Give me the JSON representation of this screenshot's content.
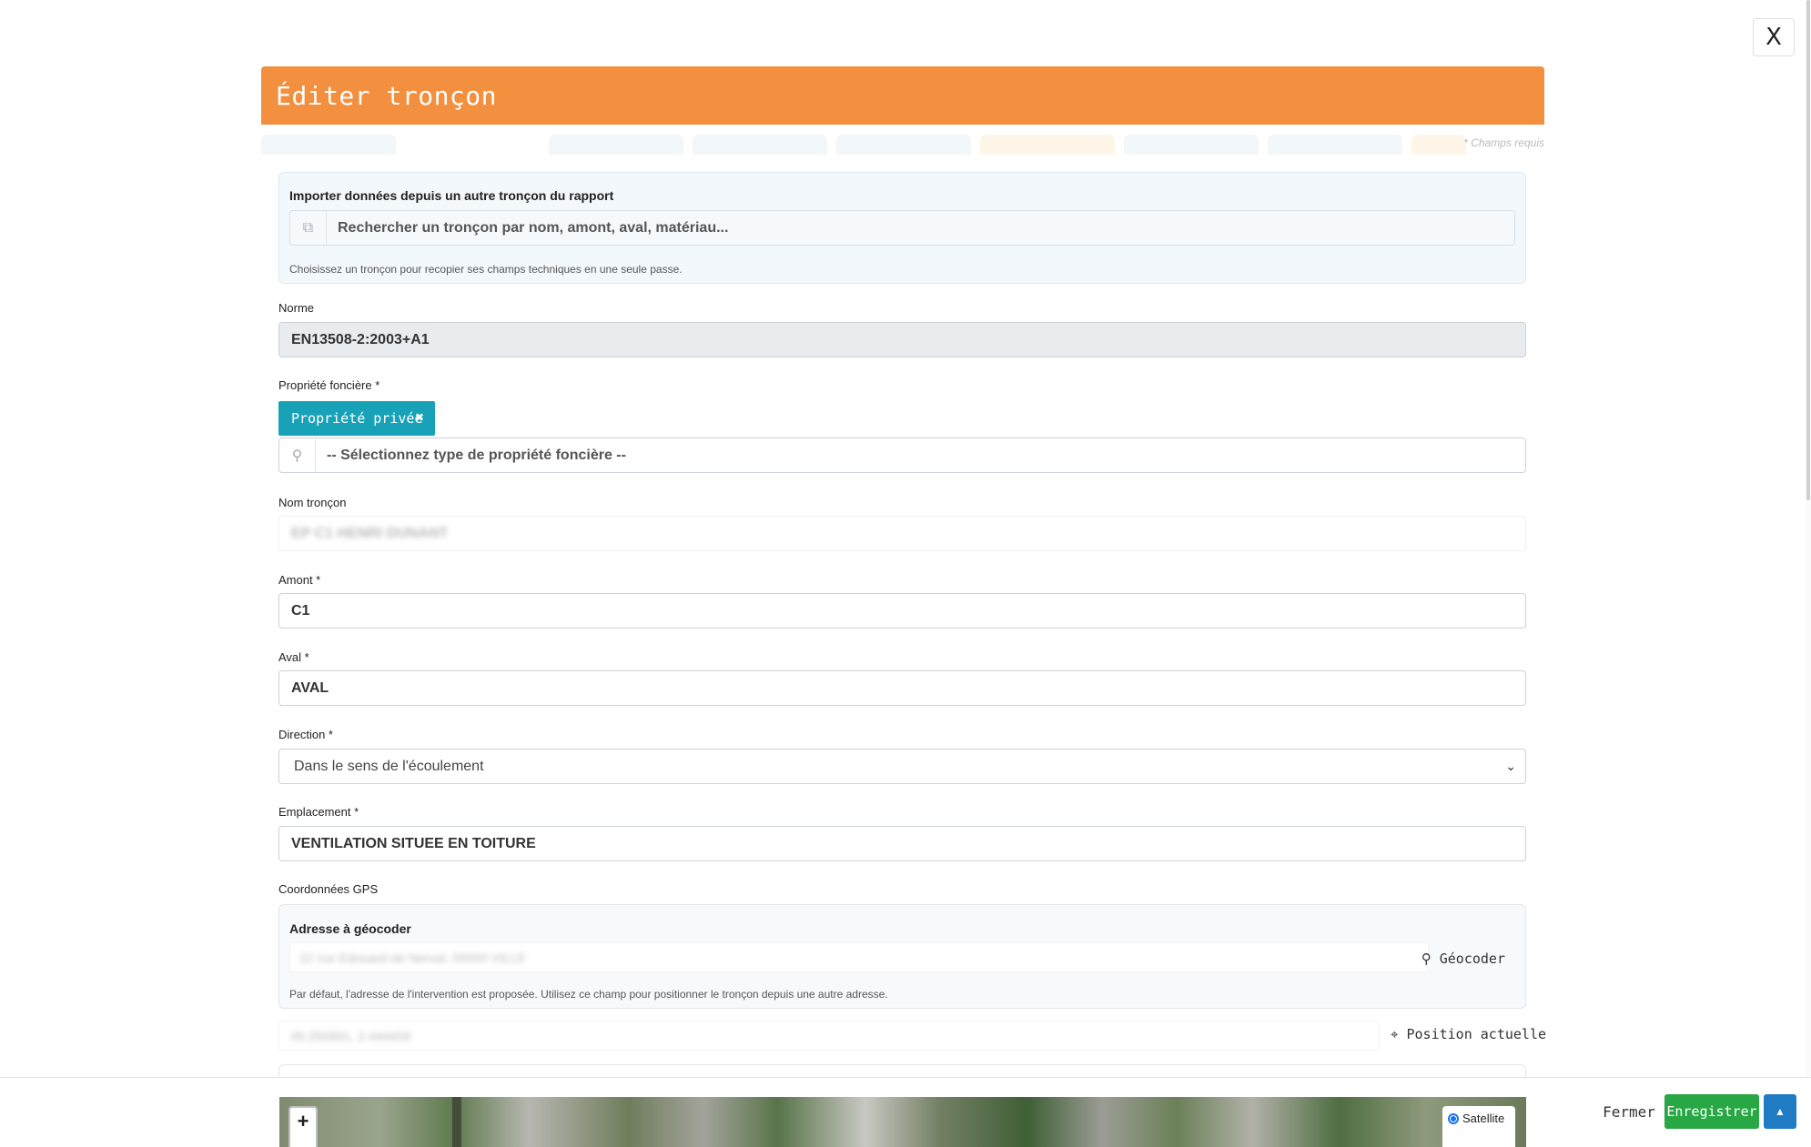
{
  "window": {
    "close_label": "X"
  },
  "modal": {
    "title": "Éditer tronçon",
    "required_note": "* Champs requis"
  },
  "import": {
    "title": "Importer données depuis un autre tronçon du rapport",
    "placeholder": "Rechercher un tronçon par nom, amont, aval, matériau...",
    "hint": "Choisissez un tronçon pour recopier ses champs techniques en une seule passe."
  },
  "fields": {
    "norme": {
      "label": "Norme",
      "value": "EN13508-2:2003+A1"
    },
    "propriete": {
      "label": "Propriété foncière *",
      "tag": "Propriété privée",
      "placeholder": "-- Sélectionnez type de propriété foncière --"
    },
    "nom_troncon": {
      "label": "Nom tronçon",
      "value": "EP C1 HENRI DUNANT"
    },
    "amont": {
      "label": "Amont *",
      "value": "C1"
    },
    "aval": {
      "label": "Aval *",
      "value": "AVAL"
    },
    "direction": {
      "label": "Direction *",
      "value": "Dans le sens de l'écoulement"
    },
    "emplacement": {
      "label": "Emplacement *",
      "value": "VENTILATION SITUEE EN TOITURE"
    },
    "gps": {
      "label": "Coordonnées GPS",
      "address_title": "Adresse à géocoder",
      "address_value": "22 rue Edouard de Nerval, 00000 VILLE",
      "geocode_label": "Géocoder",
      "address_hint": "Par défaut, l'adresse de l'intervention est proposée. Utilisez ce champ pour positionner le tronçon depuis une autre adresse.",
      "coords_value": "49.250891, 2.444459",
      "position_label": "Position actuelle"
    }
  },
  "map": {
    "zoom_in": "+",
    "layer_satellite": "Satellite"
  },
  "footer": {
    "close_label": "Fermer",
    "save_label": "Enregistrer"
  },
  "colors": {
    "header": "#f2903f",
    "tag": "#17a2b8",
    "save": "#28a745",
    "up": "#1f7bc3"
  }
}
